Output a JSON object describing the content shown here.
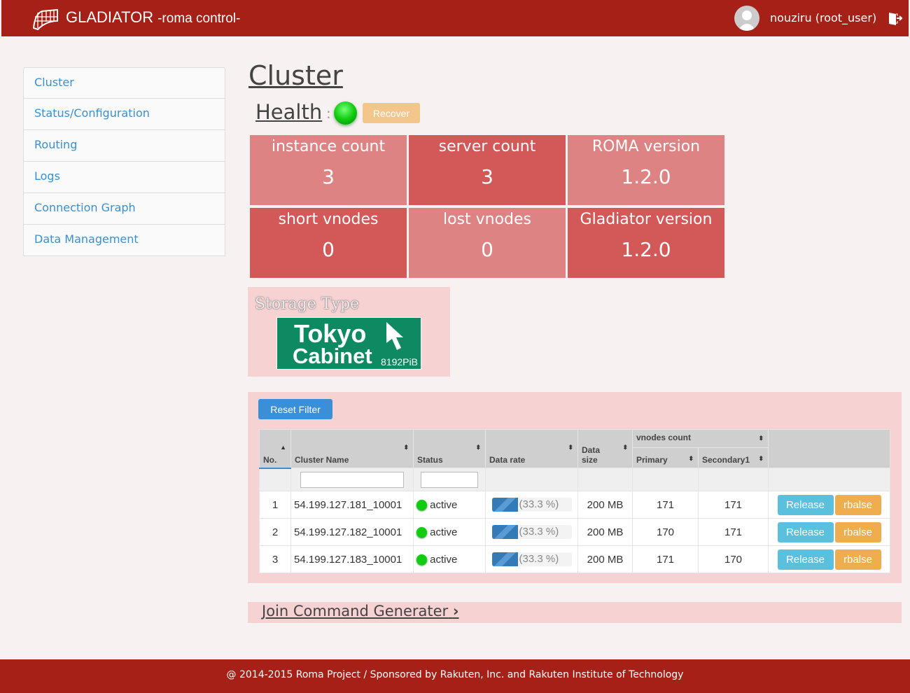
{
  "header": {
    "brand": "GLADIATOR",
    "subtitle": "-roma control-",
    "user": "nouziru (root_user)"
  },
  "sidebar": {
    "items": [
      {
        "label": "Cluster"
      },
      {
        "label": "Status/Configuration"
      },
      {
        "label": "Routing"
      },
      {
        "label": "Logs"
      },
      {
        "label": "Connection Graph"
      },
      {
        "label": "Data Management"
      }
    ]
  },
  "main": {
    "title": "Cluster",
    "health_label": "Health",
    "health_colon": ":",
    "recover_label": "Recover",
    "stats": [
      {
        "label": "instance count",
        "value": "3"
      },
      {
        "label": "server count",
        "value": "3"
      },
      {
        "label": "ROMA version",
        "value": "1.2.0"
      },
      {
        "label": "short vnodes",
        "value": "0"
      },
      {
        "label": "lost vnodes",
        "value": "0"
      },
      {
        "label": "Gladiator version",
        "value": "1.2.0"
      }
    ],
    "storage": {
      "label": "Storage Type",
      "line1": "Tokyo",
      "line2": "Cabinet",
      "size": "8192PiB"
    },
    "reset_filter": "Reset Filter",
    "table": {
      "headers": {
        "no": "No.",
        "name": "Cluster Name",
        "status": "Status",
        "rate": "Data rate",
        "size": "Data size",
        "vnodes": "vnodes count",
        "primary": "Primary",
        "secondary": "Secondary1"
      },
      "rows": [
        {
          "no": "1",
          "name": "54.199.127.181_10001",
          "status": "active",
          "rate": "(33.3 %)",
          "rate_pct": 33.3,
          "size": "200 MB",
          "primary": "171",
          "secondary": "171",
          "release": "Release",
          "rbalse": "rbalse"
        },
        {
          "no": "2",
          "name": "54.199.127.182_10001",
          "status": "active",
          "rate": "(33.3 %)",
          "rate_pct": 33.3,
          "size": "200 MB",
          "primary": "170",
          "secondary": "171",
          "release": "Release",
          "rbalse": "rbalse"
        },
        {
          "no": "3",
          "name": "54.199.127.183_10001",
          "status": "active",
          "rate": "(33.3 %)",
          "rate_pct": 33.3,
          "size": "200 MB",
          "primary": "171",
          "secondary": "170",
          "release": "Release",
          "rbalse": "rbalse"
        }
      ]
    },
    "join_link": "Join Command Generater"
  },
  "footer": {
    "text": "@ 2014-2015 Roma Project / Sponsored by Rakuten, Inc. and Rakuten Institute of Technology"
  }
}
